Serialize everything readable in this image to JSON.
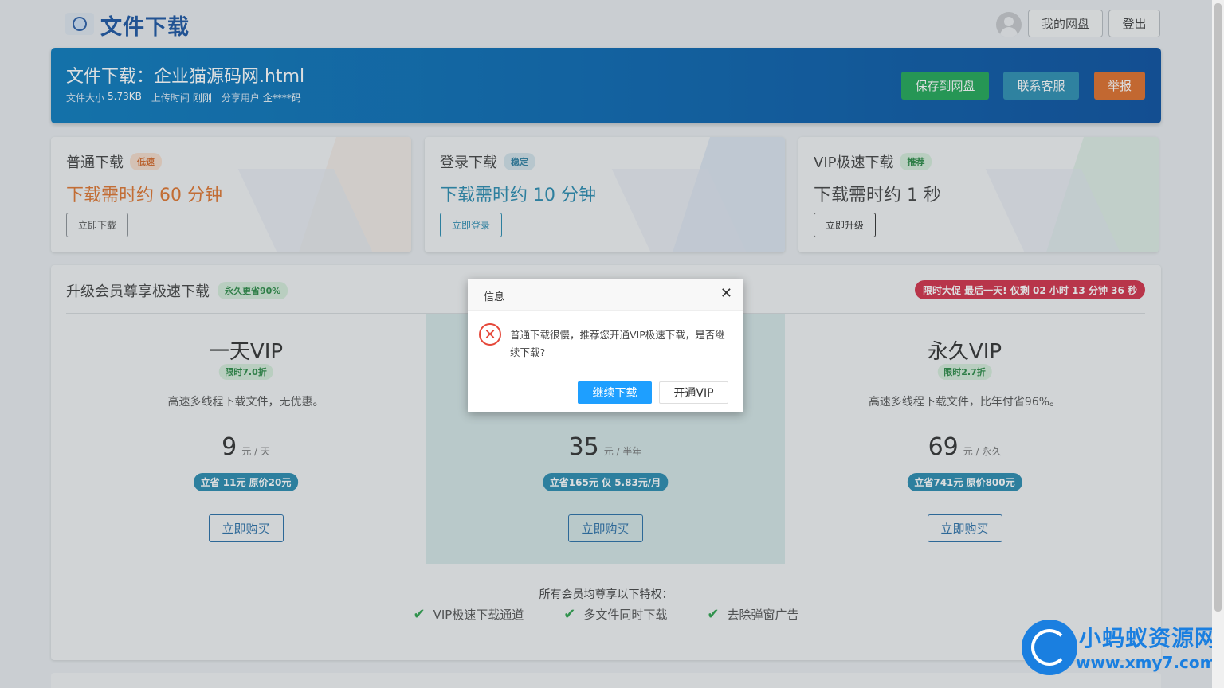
{
  "header": {
    "site_title": "文件下载",
    "my_disk_label": "我的网盘",
    "logout_label": "登出"
  },
  "file": {
    "title": "文件下载：企业猫源码网.html",
    "size_label": "文件大小",
    "size_value": "5.73KB",
    "upload_label": "上传时间",
    "upload_value": "刚刚",
    "sharer_label": "分享用户",
    "sharer_value": "企****码",
    "save_button": "保存到网盘",
    "contact_button": "联系客服",
    "report_button": "举报"
  },
  "download_options": [
    {
      "title": "普通下载",
      "tag": "低速",
      "time": "下载需时约 60 分钟",
      "button": "立即下载"
    },
    {
      "title": "登录下载",
      "tag": "稳定",
      "time": "下载需时约 10 分钟",
      "button": "立即登录"
    },
    {
      "title": "VIP极速下载",
      "tag": "推荐",
      "time": "下载需时约 1 秒",
      "button": "立即升级"
    }
  ],
  "vip_section": {
    "title": "升级会员尊享极速下载",
    "title_tag": "永久更省90%",
    "promo": "限时大促 最后一天! 仅剩 02 小时 13 分钟 36 秒",
    "plans": [
      {
        "name": "一天VIP",
        "tag": "限时7.0折",
        "desc": "高速多线程下载文件，无优惠。",
        "price": "9",
        "unit": "元 / 天",
        "save": "立省 11元 原价20元",
        "button": "立即购买"
      },
      {
        "name": "",
        "tag": "",
        "desc": "",
        "price": "35",
        "unit": "元 / 半年",
        "save": "立省165元 仅 5.83元/月",
        "button": "立即购买"
      },
      {
        "name": "永久VIP",
        "tag": "限时2.7折",
        "desc": "高速多线程下载文件，比年付省96%。",
        "price": "69",
        "unit": "元 / 永久",
        "save": "立省741元 原价800元",
        "button": "立即购买"
      }
    ],
    "perks_title": "所有会员均尊享以下特权：",
    "perks": [
      "VIP极速下载通道",
      "多文件同时下载",
      "去除弹窗广告"
    ]
  },
  "modal": {
    "title": "信息",
    "message": "普通下载很慢，推荐您开通VIP极速下载，是否继续下载?",
    "continue_button": "继续下载",
    "vip_button": "开通VIP"
  },
  "watermark": {
    "name": "小蚂蚁资源网",
    "url": "www.xmy7.com"
  },
  "colors": {
    "brand_blue": "#1d56a3",
    "banner_blue": "#0a6ab3",
    "save_green": "#22a857",
    "contact_teal": "#2d8fb3",
    "report_orange": "#e06f2b",
    "promo_red": "#d3314a",
    "modal_primary": "#1e9fff"
  }
}
